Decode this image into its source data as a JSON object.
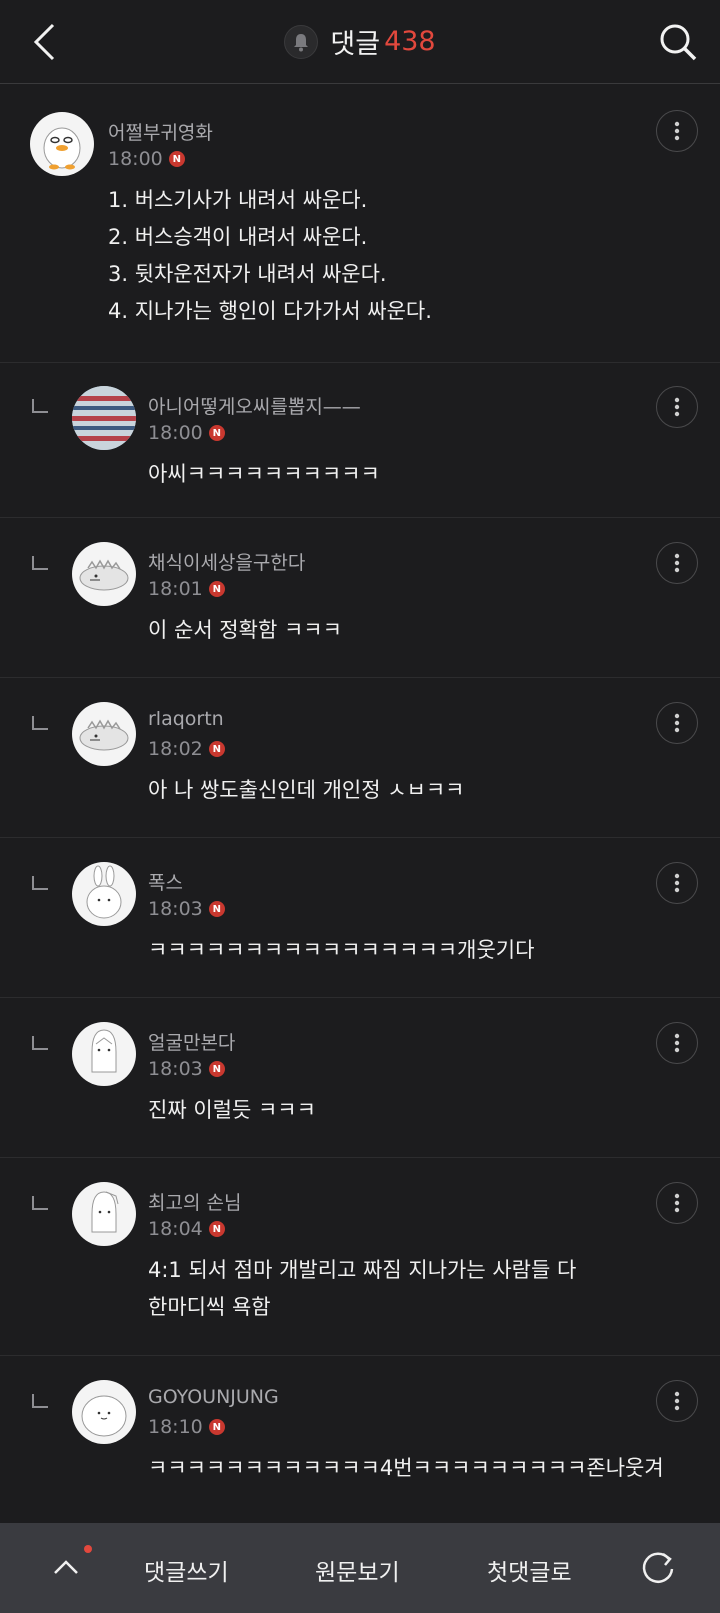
{
  "header": {
    "title": "댓글",
    "count": "438"
  },
  "comments": [
    {
      "nick": "어쩔부귀영화",
      "time": "18:00",
      "text": "1. 버스기사가 내려서 싸운다.\n2. 버스승객이 내려서 싸운다.\n3. 뒷차운전자가 내려서 싸운다.\n4. 지나가는 행인이 다가가서 싸운다.",
      "avatar_icon": "duck-avatar-icon"
    },
    {
      "nick": "아니어떻게오씨를뽑지——",
      "time": "18:00",
      "text": "아씨ㅋㅋㅋㅋㅋㅋㅋㅋㅋㅋ",
      "avatar_icon": "photo-avatar-icon"
    },
    {
      "nick": "채식이세상을구한다",
      "time": "18:01",
      "text": "이 순서 정확함 ㅋㅋㅋ",
      "avatar_icon": "dino-avatar-icon"
    },
    {
      "nick": "rlaqortn",
      "time": "18:02",
      "text": "아 나 쌍도출신인데 개인정 ㅅㅂㅋㅋ",
      "avatar_icon": "dino-avatar-icon"
    },
    {
      "nick": "폭스",
      "time": "18:03",
      "text": "ㅋㅋㅋㅋㅋㅋㅋㅋㅋㅋㅋㅋㅋㅋㅋㅋ개웃기다",
      "avatar_icon": "bunny-avatar-icon"
    },
    {
      "nick": "얼굴만본다",
      "time": "18:03",
      "text": "진짜 이럴듯 ㅋㅋㅋ",
      "avatar_icon": "penguin-avatar-icon"
    },
    {
      "nick": "최고의 손님",
      "time": "18:04",
      "text": "4:1 되서 점마 개발리고 짜짐 지나가는 사람들 다\n한마디씩 욕함",
      "avatar_icon": "unicorn-avatar-icon"
    },
    {
      "nick": "GOYOUNJUNG",
      "time": "18:10",
      "text": "ㅋㅋㅋㅋㅋㅋㅋㅋㅋㅋㅋㅋ4번ㅋㅋㅋㅋㅋㅋㅋㅋㅋ존나웃겨",
      "avatar_icon": "blob-avatar-icon"
    }
  ],
  "badge_label": "N",
  "bottom": {
    "write": "댓글쓰기",
    "original": "원문보기",
    "first": "첫댓글로"
  }
}
